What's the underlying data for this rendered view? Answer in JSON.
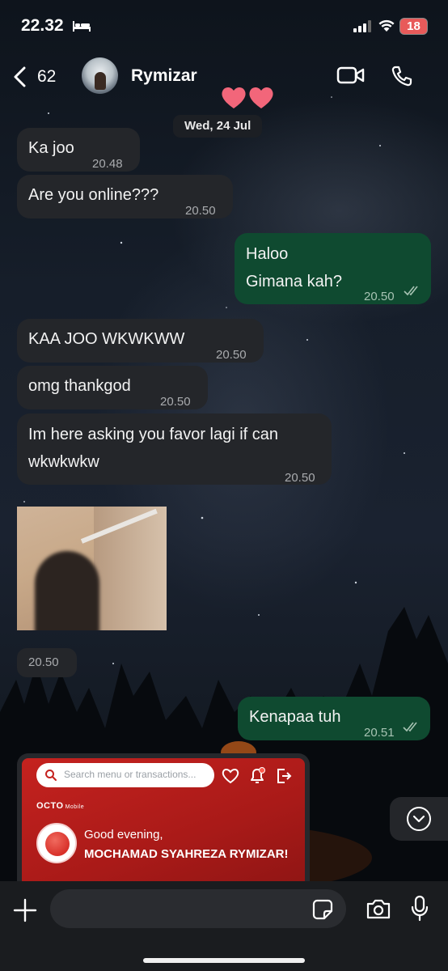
{
  "status_bar": {
    "time": "22.32",
    "focus_icon": "bed-icon",
    "battery": "18"
  },
  "header": {
    "back_count": "62",
    "contact_name": "Rymizar",
    "icons": [
      "chevron-left-icon",
      "video-call-icon",
      "phone-icon"
    ]
  },
  "date_separator": "Wed, 24 Jul",
  "messages": [
    {
      "direction": "in",
      "text": "Ka joo",
      "time": "20.48"
    },
    {
      "direction": "in",
      "text": "Are you online???",
      "time": "20.50"
    },
    {
      "direction": "out",
      "text": "Haloo",
      "text2": "Gimana kah?",
      "time": "20.50",
      "status": "read"
    },
    {
      "direction": "in",
      "text": "KAA JOO WKWKWW",
      "time": "20.50"
    },
    {
      "direction": "in",
      "text": "omg thankgod",
      "time": "20.50"
    },
    {
      "direction": "in",
      "text": "Im here asking you favor lagi if can",
      "text2": "wkwkwkw",
      "time": "20.50"
    },
    {
      "direction": "in",
      "type": "image",
      "time": "20.50"
    },
    {
      "direction": "out",
      "text": "Kenapaa tuh",
      "time": "20.51",
      "status": "read"
    }
  ],
  "shared_card": {
    "search_placeholder": "Search menu or transactions...",
    "logo": "OCTO",
    "logo_sub": "Mobile",
    "greeting": "Good evening,",
    "user_name": "MOCHAMAD SYAHREZA RYMIZAR!",
    "brand_color": "#c5221f"
  },
  "input_bar": {
    "placeholder": "",
    "icons": [
      "plus-icon",
      "sticker-icon",
      "camera-icon",
      "microphone-icon"
    ]
  },
  "colors": {
    "incoming_bubble": "#24262a",
    "outgoing_bubble": "#0f4a30"
  }
}
